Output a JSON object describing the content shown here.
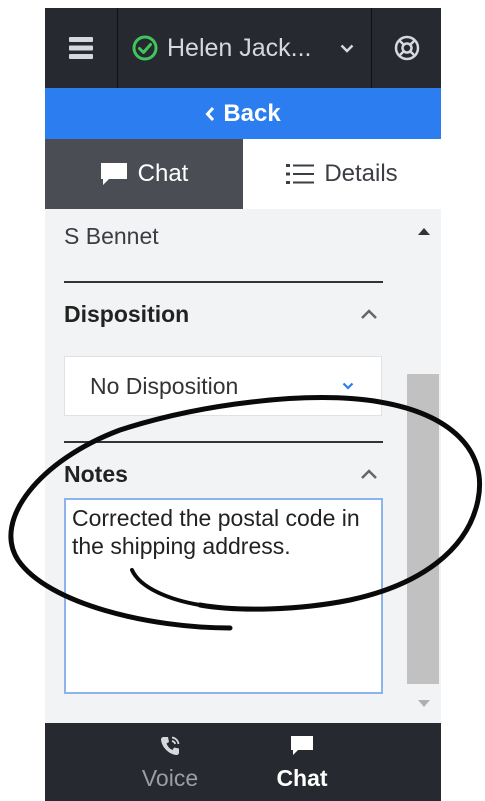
{
  "header": {
    "agent_name": "Helen Jack...",
    "status_color": "#3fc55a",
    "menu_icon": "hamburger-icon",
    "support_icon": "lifebuoy-icon"
  },
  "back_label": "Back",
  "tabs": [
    {
      "label": "Chat",
      "icon": "chat-bubble-icon",
      "active": true
    },
    {
      "label": "Details",
      "icon": "list-icon",
      "active": false
    }
  ],
  "details": {
    "contact_name": "S Bennet",
    "disposition": {
      "title": "Disposition",
      "value": "No Disposition"
    },
    "notes": {
      "title": "Notes",
      "value": "Corrected the postal code in the shipping address."
    }
  },
  "bottom_nav": [
    {
      "label": "Voice",
      "icon": "phone-icon",
      "active": false
    },
    {
      "label": "Chat",
      "icon": "chat-bubble-icon",
      "active": true
    }
  ],
  "colors": {
    "accent": "#2c7ef0",
    "dark_bar": "#26292f",
    "active_tab": "#4a4d54"
  }
}
